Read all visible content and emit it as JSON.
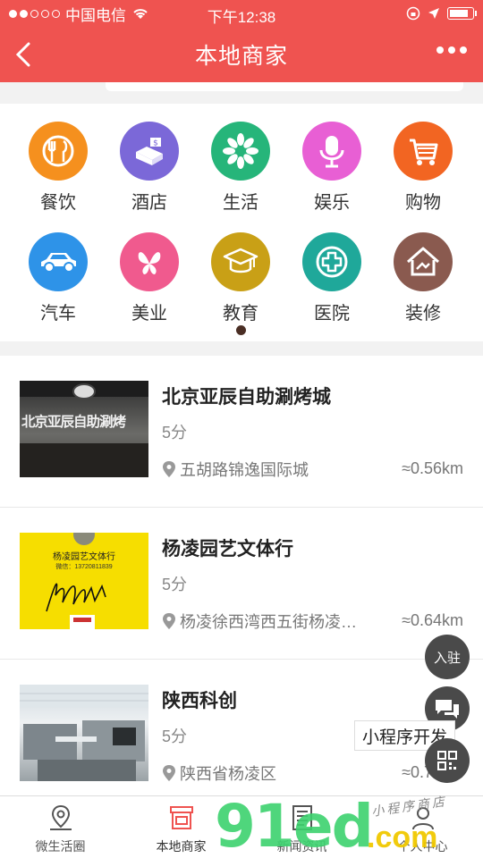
{
  "status_bar": {
    "carrier": "中国电信",
    "time": "下午12:38"
  },
  "nav": {
    "title": "本地商家"
  },
  "categories": [
    {
      "label": "餐饮",
      "icon": "utensils-icon",
      "color": "#f5901e"
    },
    {
      "label": "酒店",
      "icon": "hotel-bed-icon",
      "color": "#7b68d8"
    },
    {
      "label": "生活",
      "icon": "flower-icon",
      "color": "#26b57a"
    },
    {
      "label": "娱乐",
      "icon": "microphone-icon",
      "color": "#e85fd4"
    },
    {
      "label": "购物",
      "icon": "shopping-cart-icon",
      "color": "#f26522"
    },
    {
      "label": "汽车",
      "icon": "car-icon",
      "color": "#2e93e8"
    },
    {
      "label": "美业",
      "icon": "butterfly-icon",
      "color": "#f05a8e"
    },
    {
      "label": "教育",
      "icon": "graduation-cap-icon",
      "color": "#c9a016"
    },
    {
      "label": "医院",
      "icon": "medical-cross-icon",
      "color": "#1fa89a"
    },
    {
      "label": "装修",
      "icon": "house-icon",
      "color": "#8a5a4f"
    }
  ],
  "merchants": [
    {
      "name": "北京亚辰自助涮烤城",
      "score": "5分",
      "address": "五胡路锦逸国际城",
      "distance": "≈0.56km",
      "thumb_text": "北京亚辰自助涮烤"
    },
    {
      "name": "杨凌园艺文体行",
      "score": "5分",
      "address": "杨凌徐西湾西五街杨凌…",
      "distance": "≈0.64km",
      "thumb_text": "杨凌园艺文体行",
      "thumb_sub": "微信：13720811839"
    },
    {
      "name": "陕西科创",
      "score": "5分",
      "address": "陕西省杨凌区",
      "distance": "≈0.70km"
    }
  ],
  "floating": {
    "join_label": "入驻",
    "tooltip": "小程序开发"
  },
  "tabs": [
    {
      "label": "微生活圈",
      "icon": "location-pin-icon"
    },
    {
      "label": "本地商家",
      "icon": "shop-icon"
    },
    {
      "label": "新闻资讯",
      "icon": "news-icon"
    },
    {
      "label": "个人中心",
      "icon": "user-icon"
    }
  ],
  "watermark": {
    "main": "91ed",
    "suffix": ".com",
    "tagline": "小程序商店"
  },
  "colors": {
    "brand_red": "#ef5350",
    "pager_dot": "#4a2e24"
  }
}
